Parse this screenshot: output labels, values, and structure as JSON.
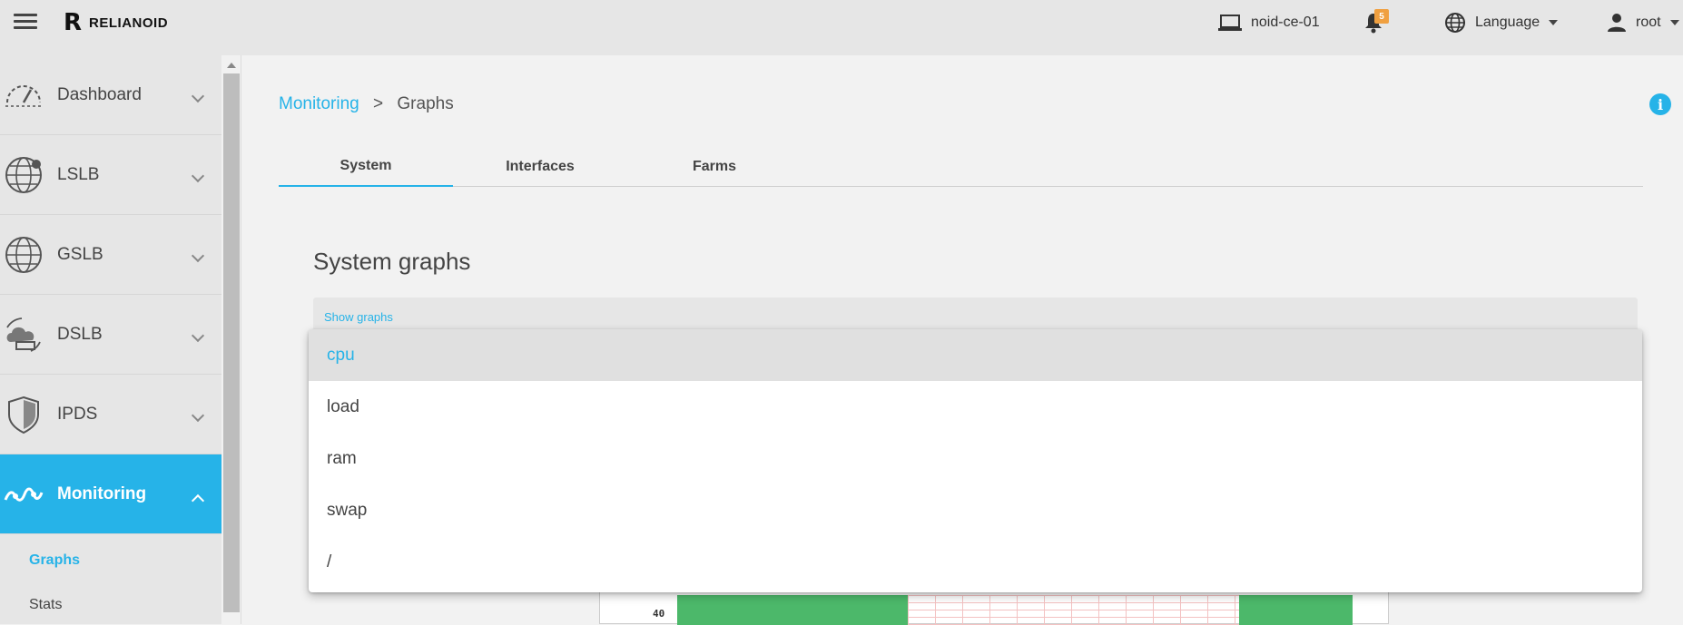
{
  "header": {
    "brand": "RELIANOID",
    "host": "noid-ce-01",
    "notifications_count": "5",
    "language_label": "Language",
    "user": "root"
  },
  "sidebar": {
    "items": [
      {
        "label": "Dashboard",
        "icon": "speedometer-icon"
      },
      {
        "label": "LSLB",
        "icon": "globe-icon"
      },
      {
        "label": "GSLB",
        "icon": "globe-icon"
      },
      {
        "label": "DSLB",
        "icon": "cloud-network-icon"
      },
      {
        "label": "IPDS",
        "icon": "shield-icon"
      },
      {
        "label": "Monitoring",
        "icon": "pulse-icon"
      }
    ],
    "sub_items": [
      {
        "label": "Graphs"
      },
      {
        "label": "Stats"
      }
    ]
  },
  "breadcrumb": {
    "parent": "Monitoring",
    "separator": ">",
    "current": "Graphs"
  },
  "tabs": [
    {
      "label": "System"
    },
    {
      "label": "Interfaces"
    },
    {
      "label": "Farms"
    }
  ],
  "section": {
    "title": "System graphs"
  },
  "select": {
    "label": "Show graphs",
    "options": [
      "cpu",
      "load",
      "ram",
      "swap",
      "/"
    ]
  },
  "graph": {
    "ytick": "40"
  },
  "colors": {
    "accent": "#26b3e8",
    "badge": "#f0a040",
    "graph_fill": "#4cb86a"
  }
}
